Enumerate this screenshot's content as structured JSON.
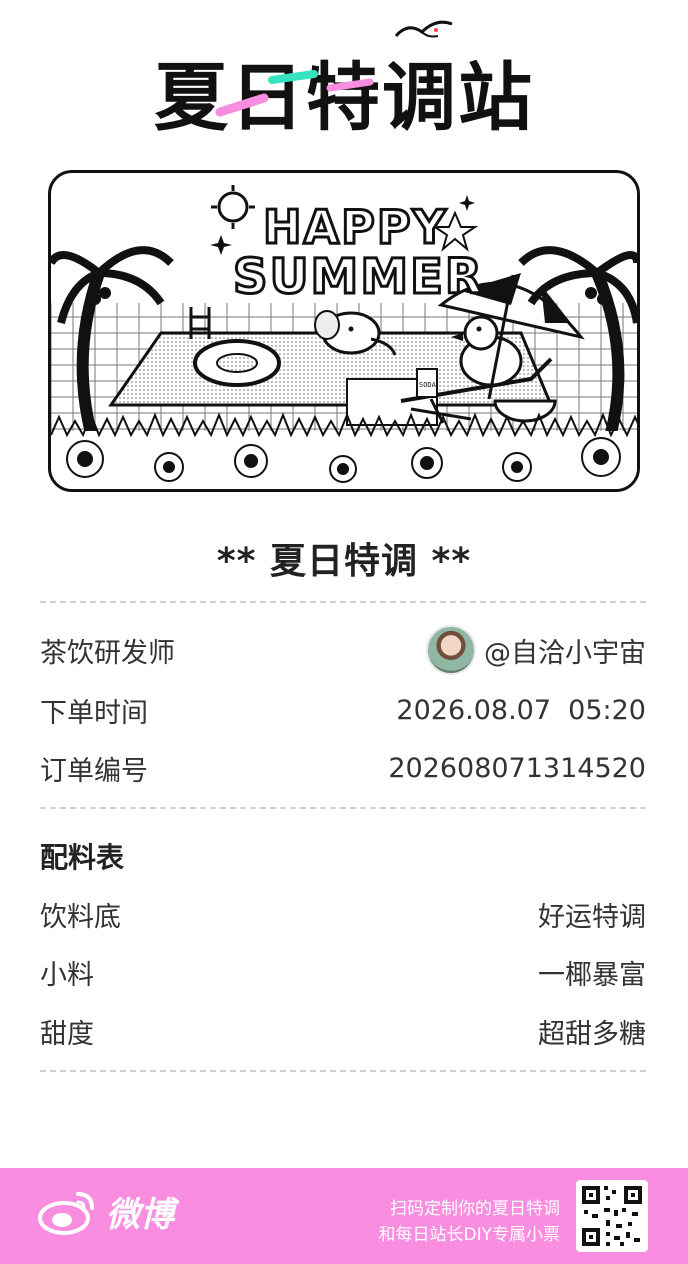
{
  "logo": {
    "title": "夏日特调站"
  },
  "banner": {
    "line1": "HAPPY",
    "line2": "SUMMER",
    "can_label": "SODA"
  },
  "receipt": {
    "title": "** 夏日特调 **",
    "rows": [
      {
        "label": "茶饮研发师",
        "value": "@自洽小宇宙"
      },
      {
        "label": "下单时间",
        "value": "2026.08.07  05:20"
      },
      {
        "label": "订单编号",
        "value": "202608071314520"
      }
    ],
    "recipe_title": "配料表",
    "recipe": [
      {
        "label": "饮料底",
        "value": "好运特调"
      },
      {
        "label": "小料",
        "value": "一椰暴富"
      },
      {
        "label": "甜度",
        "value": "超甜多糖"
      }
    ]
  },
  "footer": {
    "brand": "微博",
    "line1": "扫码定制你的夏日特调",
    "line2": "和每日站长DIY专属小票",
    "bg_color": "#f98de0"
  }
}
